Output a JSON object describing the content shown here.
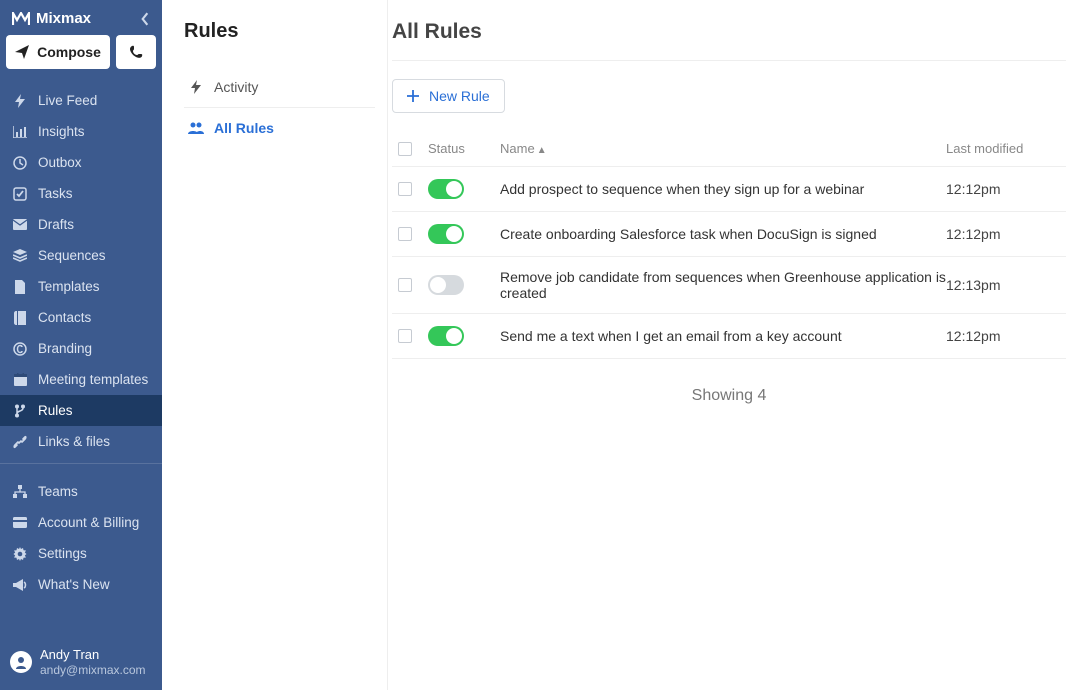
{
  "brand": {
    "name": "Mixmax"
  },
  "compose": {
    "label": "Compose"
  },
  "nav_primary": [
    {
      "label": "Live Feed",
      "icon": "bolt-icon"
    },
    {
      "label": "Insights",
      "icon": "chart-icon"
    },
    {
      "label": "Outbox",
      "icon": "clock-icon"
    },
    {
      "label": "Tasks",
      "icon": "check-icon"
    },
    {
      "label": "Drafts",
      "icon": "envelope-icon"
    },
    {
      "label": "Sequences",
      "icon": "stack-icon"
    },
    {
      "label": "Templates",
      "icon": "doc-icon"
    },
    {
      "label": "Contacts",
      "icon": "book-icon"
    },
    {
      "label": "Branding",
      "icon": "copyright-icon"
    },
    {
      "label": "Meeting templates",
      "icon": "calendar-icon"
    },
    {
      "label": "Rules",
      "icon": "branch-icon",
      "active": true
    },
    {
      "label": "Links & files",
      "icon": "link-icon"
    }
  ],
  "nav_secondary": [
    {
      "label": "Teams",
      "icon": "org-icon"
    },
    {
      "label": "Account & Billing",
      "icon": "card-icon"
    },
    {
      "label": "Settings",
      "icon": "gear-icon"
    },
    {
      "label": "What's New",
      "icon": "megaphone-icon"
    }
  ],
  "user": {
    "name": "Andy Tran",
    "email": "andy@mixmax.com"
  },
  "subpanel": {
    "title": "Rules",
    "tabs": [
      {
        "label": "Activity",
        "icon": "bolt-icon"
      },
      {
        "label": "All Rules",
        "icon": "group-icon",
        "active": true
      }
    ]
  },
  "main": {
    "title": "All Rules",
    "new_rule_label": "New Rule",
    "columns": {
      "status": "Status",
      "name": "Name",
      "modified": "Last modified"
    },
    "rows": [
      {
        "enabled": true,
        "name": "Add prospect to sequence when they sign up for a webinar",
        "modified": "12:12pm"
      },
      {
        "enabled": true,
        "name": "Create onboarding Salesforce task when DocuSign is signed",
        "modified": "12:12pm"
      },
      {
        "enabled": false,
        "name": "Remove job candidate from sequences when Greenhouse application is created",
        "modified": "12:13pm"
      },
      {
        "enabled": true,
        "name": "Send me a text when I get an email from a key account",
        "modified": "12:12pm"
      }
    ],
    "showing": "Showing 4"
  }
}
